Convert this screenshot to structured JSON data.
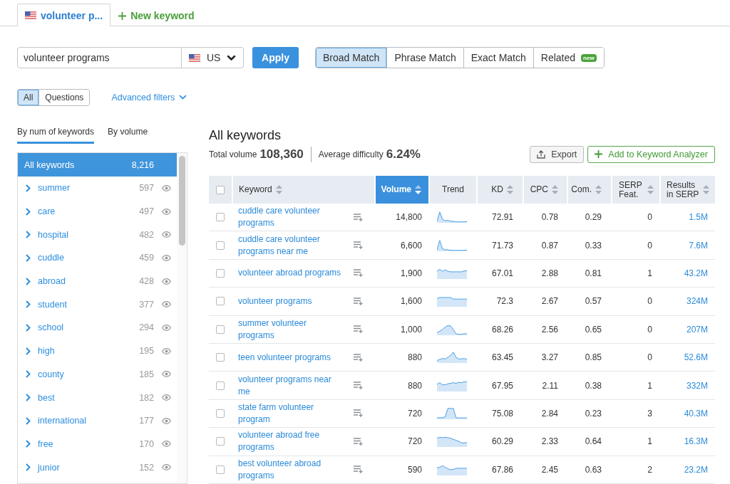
{
  "tabs": [
    {
      "kind": "keyword",
      "label": "volunteer p...",
      "selected": true
    },
    {
      "kind": "add",
      "label": "New keyword",
      "selected": false
    }
  ],
  "search": {
    "value": "volunteer programs",
    "country": "US",
    "apply_button": "Apply"
  },
  "match_types": [
    {
      "label": "Broad Match",
      "selected": true
    },
    {
      "label": "Phrase Match",
      "selected": false
    },
    {
      "label": "Exact Match",
      "selected": false
    },
    {
      "label": "Related",
      "selected": false,
      "badge": "new"
    }
  ],
  "question_filter": [
    {
      "label": "All",
      "selected": true
    },
    {
      "label": "Questions",
      "selected": false
    }
  ],
  "advanced_filters": {
    "label": "Advanced filters",
    "expanded": false
  },
  "sidebar": {
    "tabs": [
      {
        "label": "By num of keywords",
        "selected": true
      },
      {
        "label": "By volume",
        "selected": false
      }
    ],
    "all_keywords": {
      "label": "All keywords",
      "count": "8,216",
      "selected": true
    },
    "groups": [
      {
        "label": "summer",
        "count": "597",
        "selected": false,
        "expanded": false
      },
      {
        "label": "care",
        "count": "497",
        "selected": false,
        "expanded": false
      },
      {
        "label": "hospital",
        "count": "482",
        "selected": false,
        "expanded": false
      },
      {
        "label": "cuddle",
        "count": "459",
        "selected": false,
        "expanded": false
      },
      {
        "label": "abroad",
        "count": "428",
        "selected": false,
        "expanded": false
      },
      {
        "label": "student",
        "count": "377",
        "selected": false,
        "expanded": false
      },
      {
        "label": "school",
        "count": "294",
        "selected": false,
        "expanded": false
      },
      {
        "label": "high",
        "count": "195",
        "selected": false,
        "expanded": false
      },
      {
        "label": "county",
        "count": "185",
        "selected": false,
        "expanded": false
      },
      {
        "label": "best",
        "count": "182",
        "selected": false,
        "expanded": false
      },
      {
        "label": "international",
        "count": "177",
        "selected": false,
        "expanded": false
      },
      {
        "label": "free",
        "count": "170",
        "selected": false,
        "expanded": false
      },
      {
        "label": "junior",
        "count": "152",
        "selected": false,
        "expanded": false
      }
    ]
  },
  "summary": {
    "title": "All keywords",
    "total_volume_label": "Total volume",
    "total_volume": "108,360",
    "difficulty_label": "Average difficulty",
    "difficulty": "6.24%"
  },
  "actions": [
    {
      "kind": "export",
      "label": "Export"
    },
    {
      "kind": "add",
      "label": "Add to Keyword Analyzer"
    }
  ],
  "table": {
    "select_all": {
      "checked": false
    },
    "columns": [
      {
        "label": "Keyword",
        "sortable": true,
        "selected": false
      },
      {
        "label": "Volume",
        "sortable": true,
        "selected": true
      },
      {
        "label": "Trend",
        "sortable": false,
        "selected": false
      },
      {
        "label": "KD",
        "sortable": true,
        "selected": false
      },
      {
        "label": "CPC",
        "sortable": true,
        "selected": false
      },
      {
        "label": "Com.",
        "sortable": true,
        "selected": false
      },
      {
        "label": "SERP Feat.",
        "sortable": true,
        "selected": false
      },
      {
        "label": "Results in SERP",
        "sortable": true,
        "selected": false
      }
    ],
    "rows": [
      {
        "checked": false,
        "keyword": "cuddle care volunteer programs",
        "volume": "14,800",
        "kd": "72.91",
        "cpc": "0.78",
        "competition": "0.29",
        "serp_features": "0",
        "results": "1.5M"
      },
      {
        "checked": false,
        "keyword": "cuddle care volunteer programs near me",
        "volume": "6,600",
        "kd": "71.73",
        "cpc": "0.87",
        "competition": "0.33",
        "serp_features": "0",
        "results": "7.6M"
      },
      {
        "checked": false,
        "keyword": "volunteer abroad programs",
        "volume": "1,900",
        "kd": "67.01",
        "cpc": "2.88",
        "competition": "0.81",
        "serp_features": "1",
        "results": "43.2M"
      },
      {
        "checked": false,
        "keyword": "volunteer programs",
        "volume": "1,600",
        "kd": "72.3",
        "cpc": "2.67",
        "competition": "0.57",
        "serp_features": "0",
        "results": "324M"
      },
      {
        "checked": false,
        "keyword": "summer volunteer programs",
        "volume": "1,000",
        "kd": "68.26",
        "cpc": "2.56",
        "competition": "0.65",
        "serp_features": "0",
        "results": "207M"
      },
      {
        "checked": false,
        "keyword": "teen volunteer programs",
        "volume": "880",
        "kd": "63.45",
        "cpc": "3.27",
        "competition": "0.85",
        "serp_features": "0",
        "results": "52.6M"
      },
      {
        "checked": false,
        "keyword": "volunteer programs near me",
        "volume": "880",
        "kd": "67.95",
        "cpc": "2.11",
        "competition": "0.38",
        "serp_features": "1",
        "results": "332M"
      },
      {
        "checked": false,
        "keyword": "state farm volunteer program",
        "volume": "720",
        "kd": "75.08",
        "cpc": "2.84",
        "competition": "0.23",
        "serp_features": "3",
        "results": "40.3M"
      },
      {
        "checked": false,
        "keyword": "volunteer abroad free programs",
        "volume": "720",
        "kd": "60.29",
        "cpc": "2.33",
        "competition": "0.64",
        "serp_features": "1",
        "results": "16.3M"
      },
      {
        "checked": false,
        "keyword": "best volunteer abroad programs",
        "volume": "590",
        "kd": "67.86",
        "cpc": "2.45",
        "competition": "0.63",
        "serp_features": "2",
        "results": "23.2M"
      }
    ]
  }
}
